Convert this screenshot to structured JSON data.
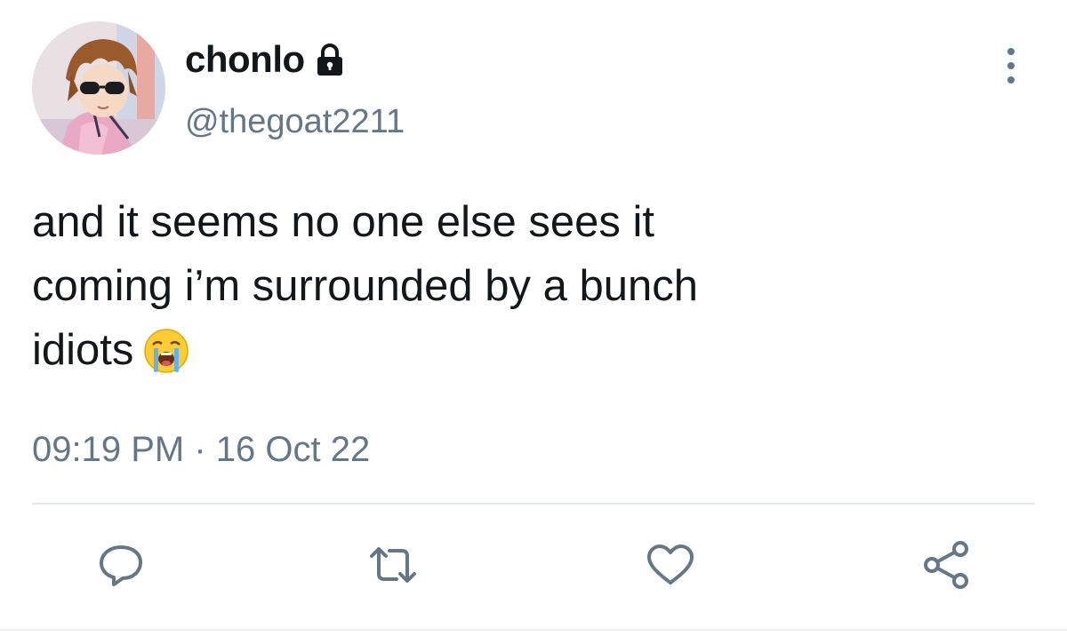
{
  "author": {
    "display_name": "chonlo",
    "handle": "@thegoat2211",
    "protected": true,
    "avatar_icon": "anime-avatar"
  },
  "tweet": {
    "lines": [
      "and it seems no one else sees it",
      "coming i’m surrounded by a bunch",
      "idiots"
    ],
    "emoji": "loudly-crying-face-emoji",
    "timestamp": "09:19 PM · 16 Oct 22"
  },
  "actions": {
    "reply_icon": "reply-icon",
    "retweet_icon": "retweet-icon",
    "like_icon": "heart-icon",
    "share_icon": "share-icon",
    "more_icon": "more-vertical-icon"
  },
  "colors": {
    "text": "#14171a",
    "secondary": "#657786",
    "divider": "#e1e8ed"
  }
}
